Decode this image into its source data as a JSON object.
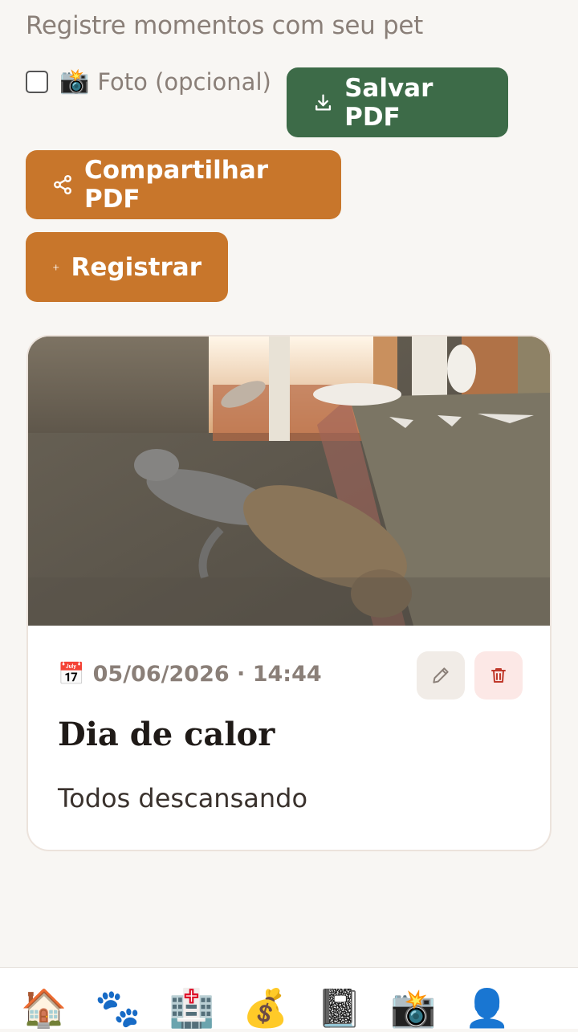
{
  "header": {
    "subtitle": "Registre momentos com seu pet"
  },
  "form": {
    "photo_label": "Foto (opcional)",
    "photo_emoji": "📸",
    "photo_checked": false
  },
  "actions": {
    "save_pdf": "Salvar PDF",
    "share_pdf": "Compartilhar PDF",
    "register": "Registrar"
  },
  "entries": [
    {
      "date_emoji": "📅",
      "datetime": "05/06/2026 · 14:44",
      "title": "Dia de calor",
      "description": "Todos descansando",
      "photo": "cats-resting-photo"
    }
  ],
  "nav": {
    "items": [
      {
        "icon": "house-icon",
        "glyph": "🏠"
      },
      {
        "icon": "paw-icon",
        "glyph": "🐾"
      },
      {
        "icon": "hospital-icon",
        "glyph": "🏥"
      },
      {
        "icon": "money-bag-icon",
        "glyph": "💰"
      },
      {
        "icon": "notebook-icon",
        "glyph": "📓"
      },
      {
        "icon": "camera-flash-icon",
        "glyph": "📸"
      },
      {
        "icon": "profile-icon",
        "glyph": "👤"
      }
    ]
  },
  "colors": {
    "save": "#3d6b48",
    "accent": "#c8762b",
    "background": "#f8f6f3"
  }
}
